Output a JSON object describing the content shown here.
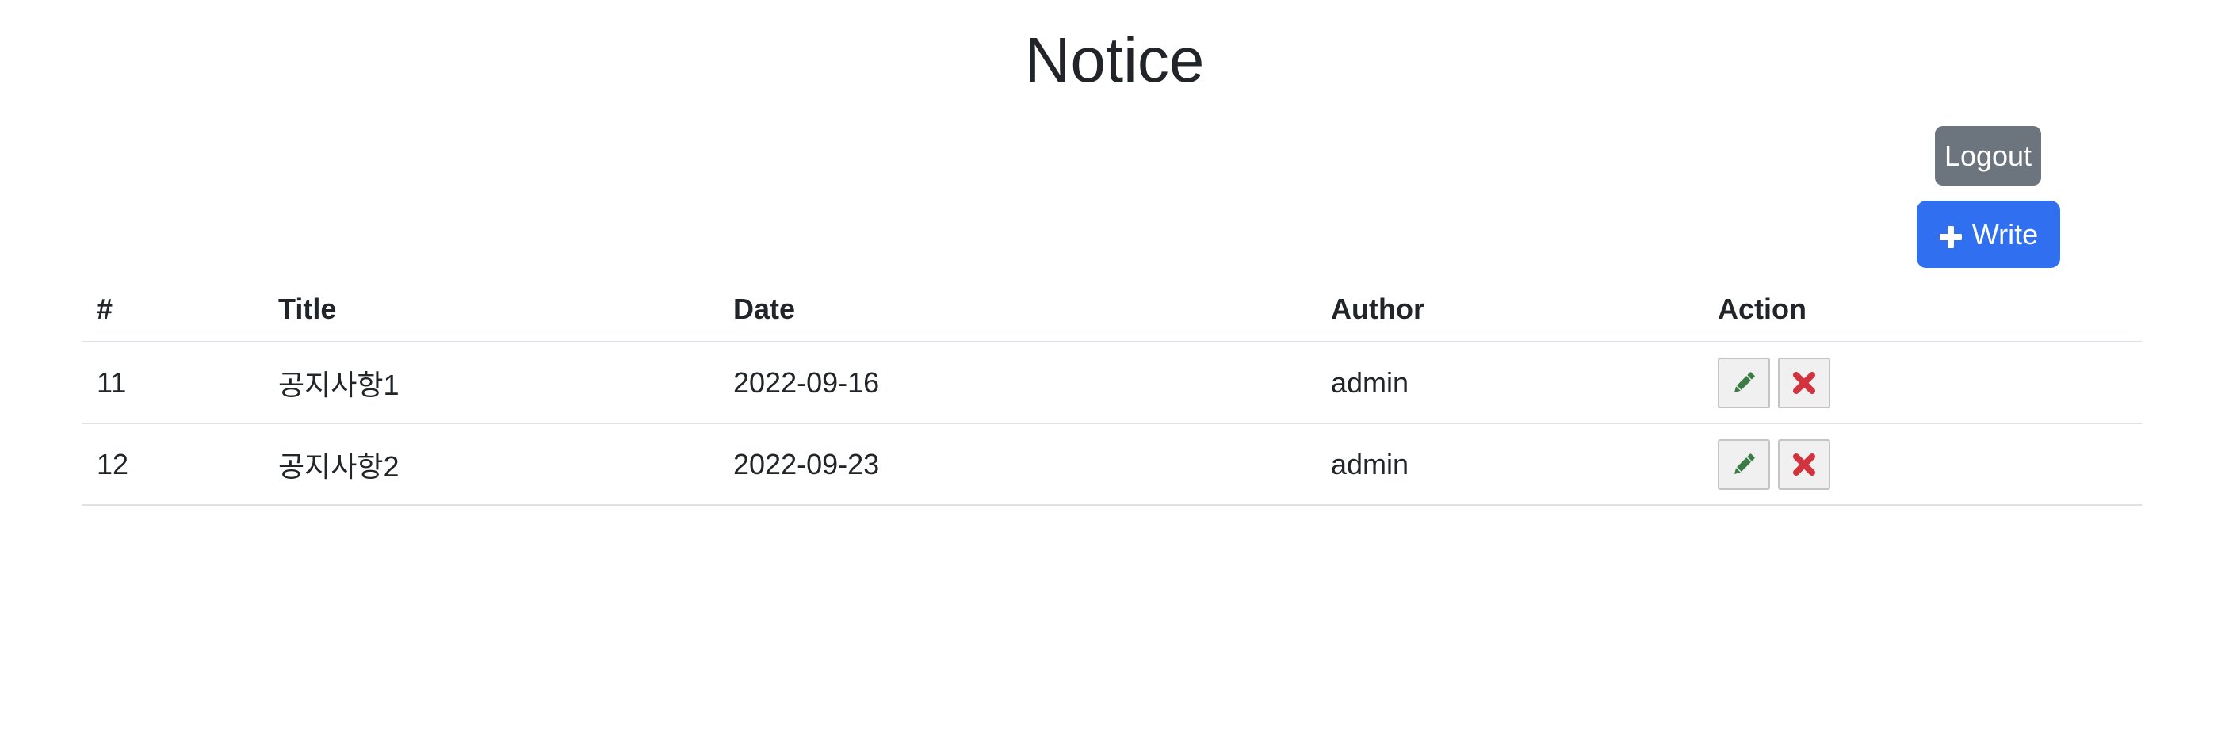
{
  "page": {
    "title": "Notice"
  },
  "toolbar": {
    "logout_label": "Logout",
    "write_label": "Write"
  },
  "table": {
    "headers": [
      "#",
      "Title",
      "Date",
      "Author",
      "Action"
    ],
    "rows": [
      {
        "id": "11",
        "title": "공지사항1",
        "date": "2022-09-16",
        "author": "admin"
      },
      {
        "id": "12",
        "title": "공지사항2",
        "date": "2022-09-23",
        "author": "admin"
      }
    ]
  },
  "icons": {
    "write": "plus-icon",
    "edit": "pencil-icon",
    "delete": "x-icon"
  },
  "colors": {
    "logout_button": "#6c757d",
    "write_button": "#2f6ff0",
    "edit_icon": "#3a7d44",
    "delete_icon": "#d1343e"
  }
}
